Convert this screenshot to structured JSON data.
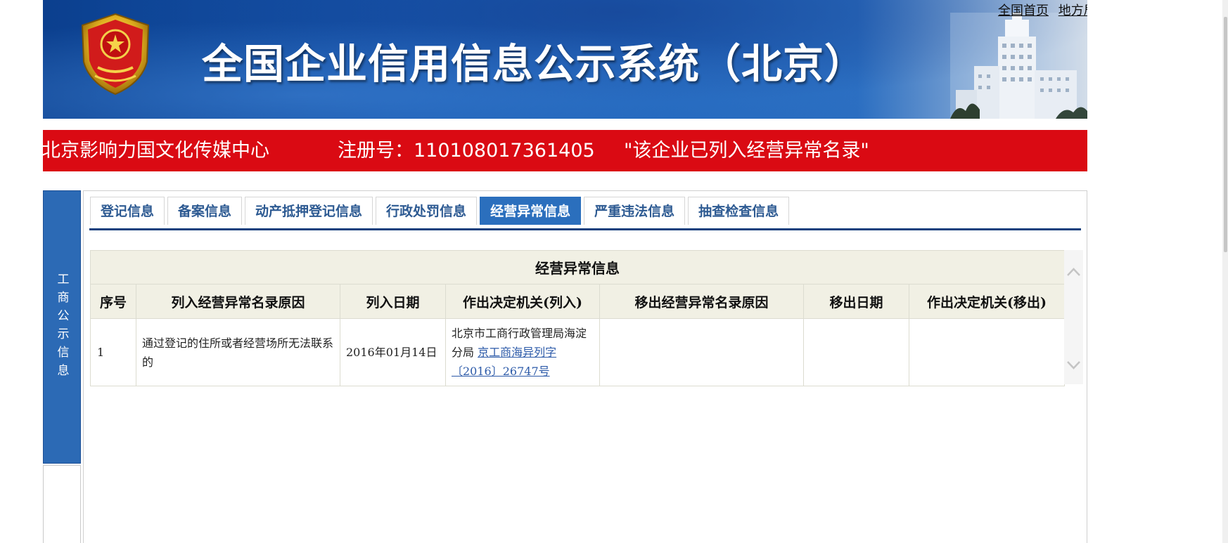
{
  "header": {
    "title": "全国企业信用信息公示系统（北京）",
    "links": [
      "全国首页",
      "地方局首页"
    ]
  },
  "notice": {
    "company": "北京影响力国文化传媒中心",
    "reg_label": "注册号：110108017361405",
    "status": "\"该企业已列入经营异常名录\""
  },
  "side": {
    "label": "工商公示信息"
  },
  "tabs": [
    {
      "label": "登记信息",
      "active": false
    },
    {
      "label": "备案信息",
      "active": false
    },
    {
      "label": "动产抵押登记信息",
      "active": false
    },
    {
      "label": "行政处罚信息",
      "active": false
    },
    {
      "label": "经营异常信息",
      "active": true
    },
    {
      "label": "严重违法信息",
      "active": false
    },
    {
      "label": "抽查检查信息",
      "active": false
    }
  ],
  "table": {
    "caption": "经营异常信息",
    "columns": [
      "序号",
      "列入经营异常名录原因",
      "列入日期",
      "作出决定机关(列入)",
      "移出经营异常名录原因",
      "移出日期",
      "作出决定机关(移出)"
    ],
    "rows": [
      {
        "index": "1",
        "reason": "通过登记的住所或者经营场所无法联系的",
        "date": "2016年01月14日",
        "authority": "北京市工商行政管理局海淀分局",
        "doc_no": "京工商海异列字〔2016〕26747号",
        "removal_reason": "",
        "removal_date": "",
        "removal_authority": ""
      }
    ]
  },
  "colors": {
    "banner_blue": "#1656ad",
    "notice_red": "#da0a13",
    "tab_active": "#2b6fbd",
    "table_header_bg": "#f1f0e4"
  },
  "icons": [
    "national-emblem-icon",
    "building-illustration",
    "scroll-up-icon",
    "scroll-down-icon"
  ]
}
